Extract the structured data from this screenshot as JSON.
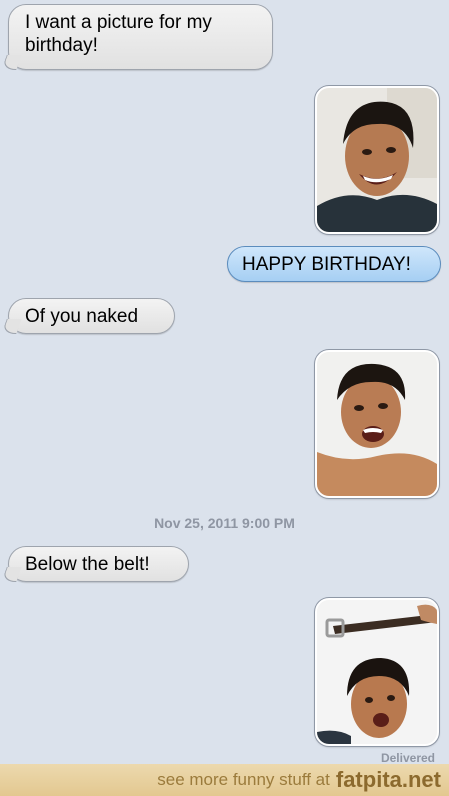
{
  "messages": {
    "m1": "I want a picture for my birthday!",
    "m2": "HAPPY BIRTHDAY!",
    "m3": "Of you naked",
    "m4": "Below the belt!"
  },
  "timestamp": "Nov 25, 2011 9:00 PM",
  "status": "Delivered",
  "footer": {
    "text": "see more funny stuff at",
    "site": "fatpita.net"
  },
  "colors": {
    "background": "#dbe2ec",
    "incoming_bubble": "#e8e8e8",
    "outgoing_bubble": "#b9daf7",
    "footer_band": "#e7cf9b",
    "footer_text": "#9b7b3c"
  }
}
